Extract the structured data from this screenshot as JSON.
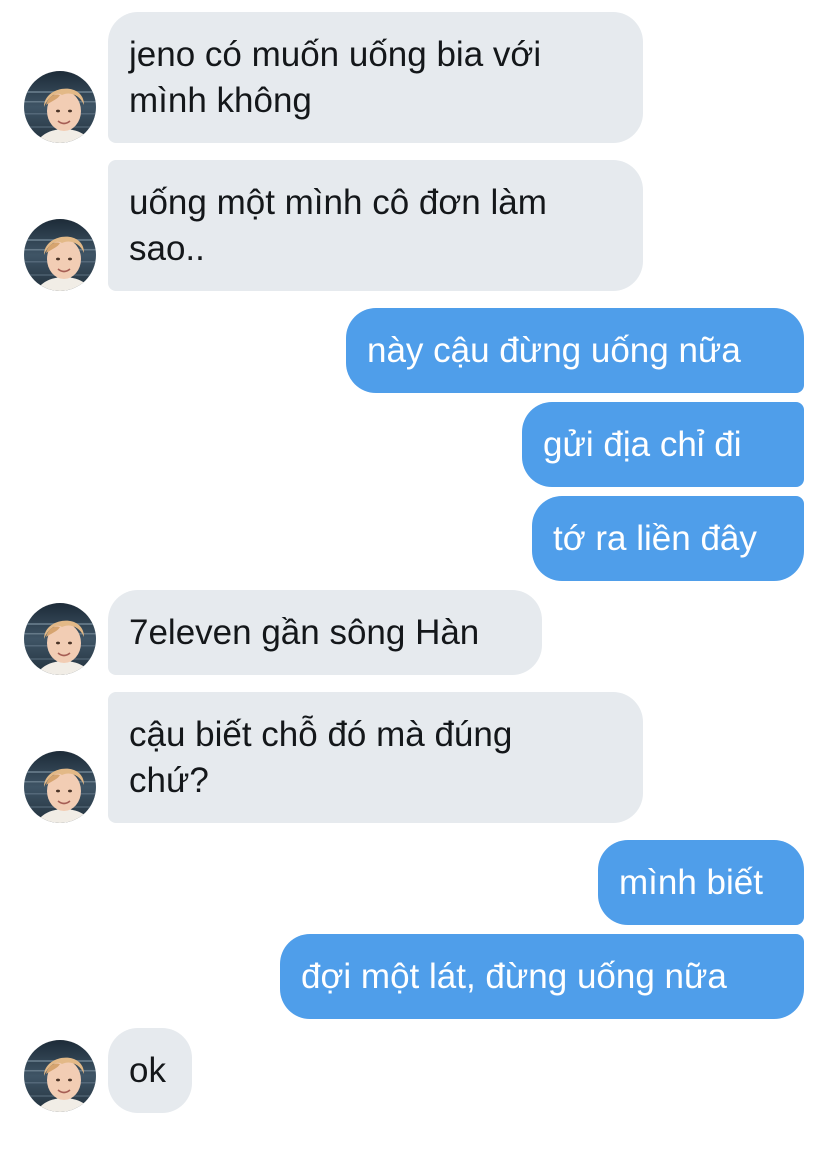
{
  "conversation": {
    "messages": [
      {
        "side": "in",
        "text": "jeno có muốn uống bia với\nmình không",
        "avatar": true
      },
      {
        "side": "in",
        "text": "uống một mình cô đơn làm\nsao..",
        "avatar": true
      },
      {
        "side": "out",
        "text": "này cậu đừng uống nữa"
      },
      {
        "side": "out",
        "text": "gửi địa chỉ đi"
      },
      {
        "side": "out",
        "text": "tớ ra liền đây"
      },
      {
        "side": "in",
        "text": "7eleven gần sông Hàn",
        "avatar": true
      },
      {
        "side": "in",
        "text": "cậu biết chỗ đó mà đúng\nchứ?",
        "avatar": true
      },
      {
        "side": "out",
        "text": "mình biết"
      },
      {
        "side": "out",
        "text": "đợi một lát, đừng uống nữa"
      },
      {
        "side": "in",
        "text": "ok",
        "avatar": true
      }
    ]
  },
  "colors": {
    "incoming_bubble": "#e6eaee",
    "outgoing_bubble": "#4f9eea",
    "incoming_text": "#14171a",
    "outgoing_text": "#ffffff"
  },
  "icons": {
    "avatar": "user-avatar-photo"
  }
}
